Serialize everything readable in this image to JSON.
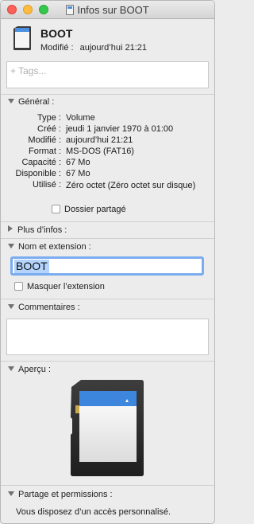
{
  "window": {
    "title": "Infos sur BOOT"
  },
  "header": {
    "name": "BOOT",
    "modified_label": "Modifié :",
    "modified_value": "aujourd’hui 21:21"
  },
  "tags": {
    "placeholder": "+ Tags..."
  },
  "sections": {
    "general": {
      "label": "Général :"
    },
    "more_info": {
      "label": "Plus d’infos :"
    },
    "name_ext": {
      "label": "Nom et extension :"
    },
    "comments": {
      "label": "Commentaires :"
    },
    "preview": {
      "label": "Aperçu :"
    },
    "sharing": {
      "label": "Partage et permissions :"
    }
  },
  "general": {
    "rows": [
      {
        "key": "Type :",
        "value": "Volume"
      },
      {
        "key": "Créé :",
        "value": "jeudi 1 janvier 1970 à 01:00"
      },
      {
        "key": "Modifié :",
        "value": "aujourd’hui 21:21"
      },
      {
        "key": "Format :",
        "value": "MS-DOS (FAT16)"
      },
      {
        "key": "Capacité :",
        "value": "67 Mo"
      },
      {
        "key": "Disponible :",
        "value": "67 Mo"
      },
      {
        "key": "Utilisé :",
        "value": "Zéro octet (Zéro octet sur disque)"
      }
    ],
    "shared_folder_label": "Dossier partagé",
    "shared_folder_checked": false
  },
  "name_ext": {
    "name_value": "BOOT",
    "hide_ext_label": "Masquer l’extension",
    "hide_ext_checked": false
  },
  "comments": {
    "value": ""
  },
  "sharing": {
    "text": "Vous disposez d’un accès personnalisé."
  },
  "icons": {
    "header": "sd-card-icon",
    "title": "sd-card-icon",
    "preview": "sd-card-preview-icon"
  },
  "colors": {
    "accent": "#4a8fe0",
    "selection": "#b4d4fd",
    "focus_ring": "#7bacf0"
  }
}
